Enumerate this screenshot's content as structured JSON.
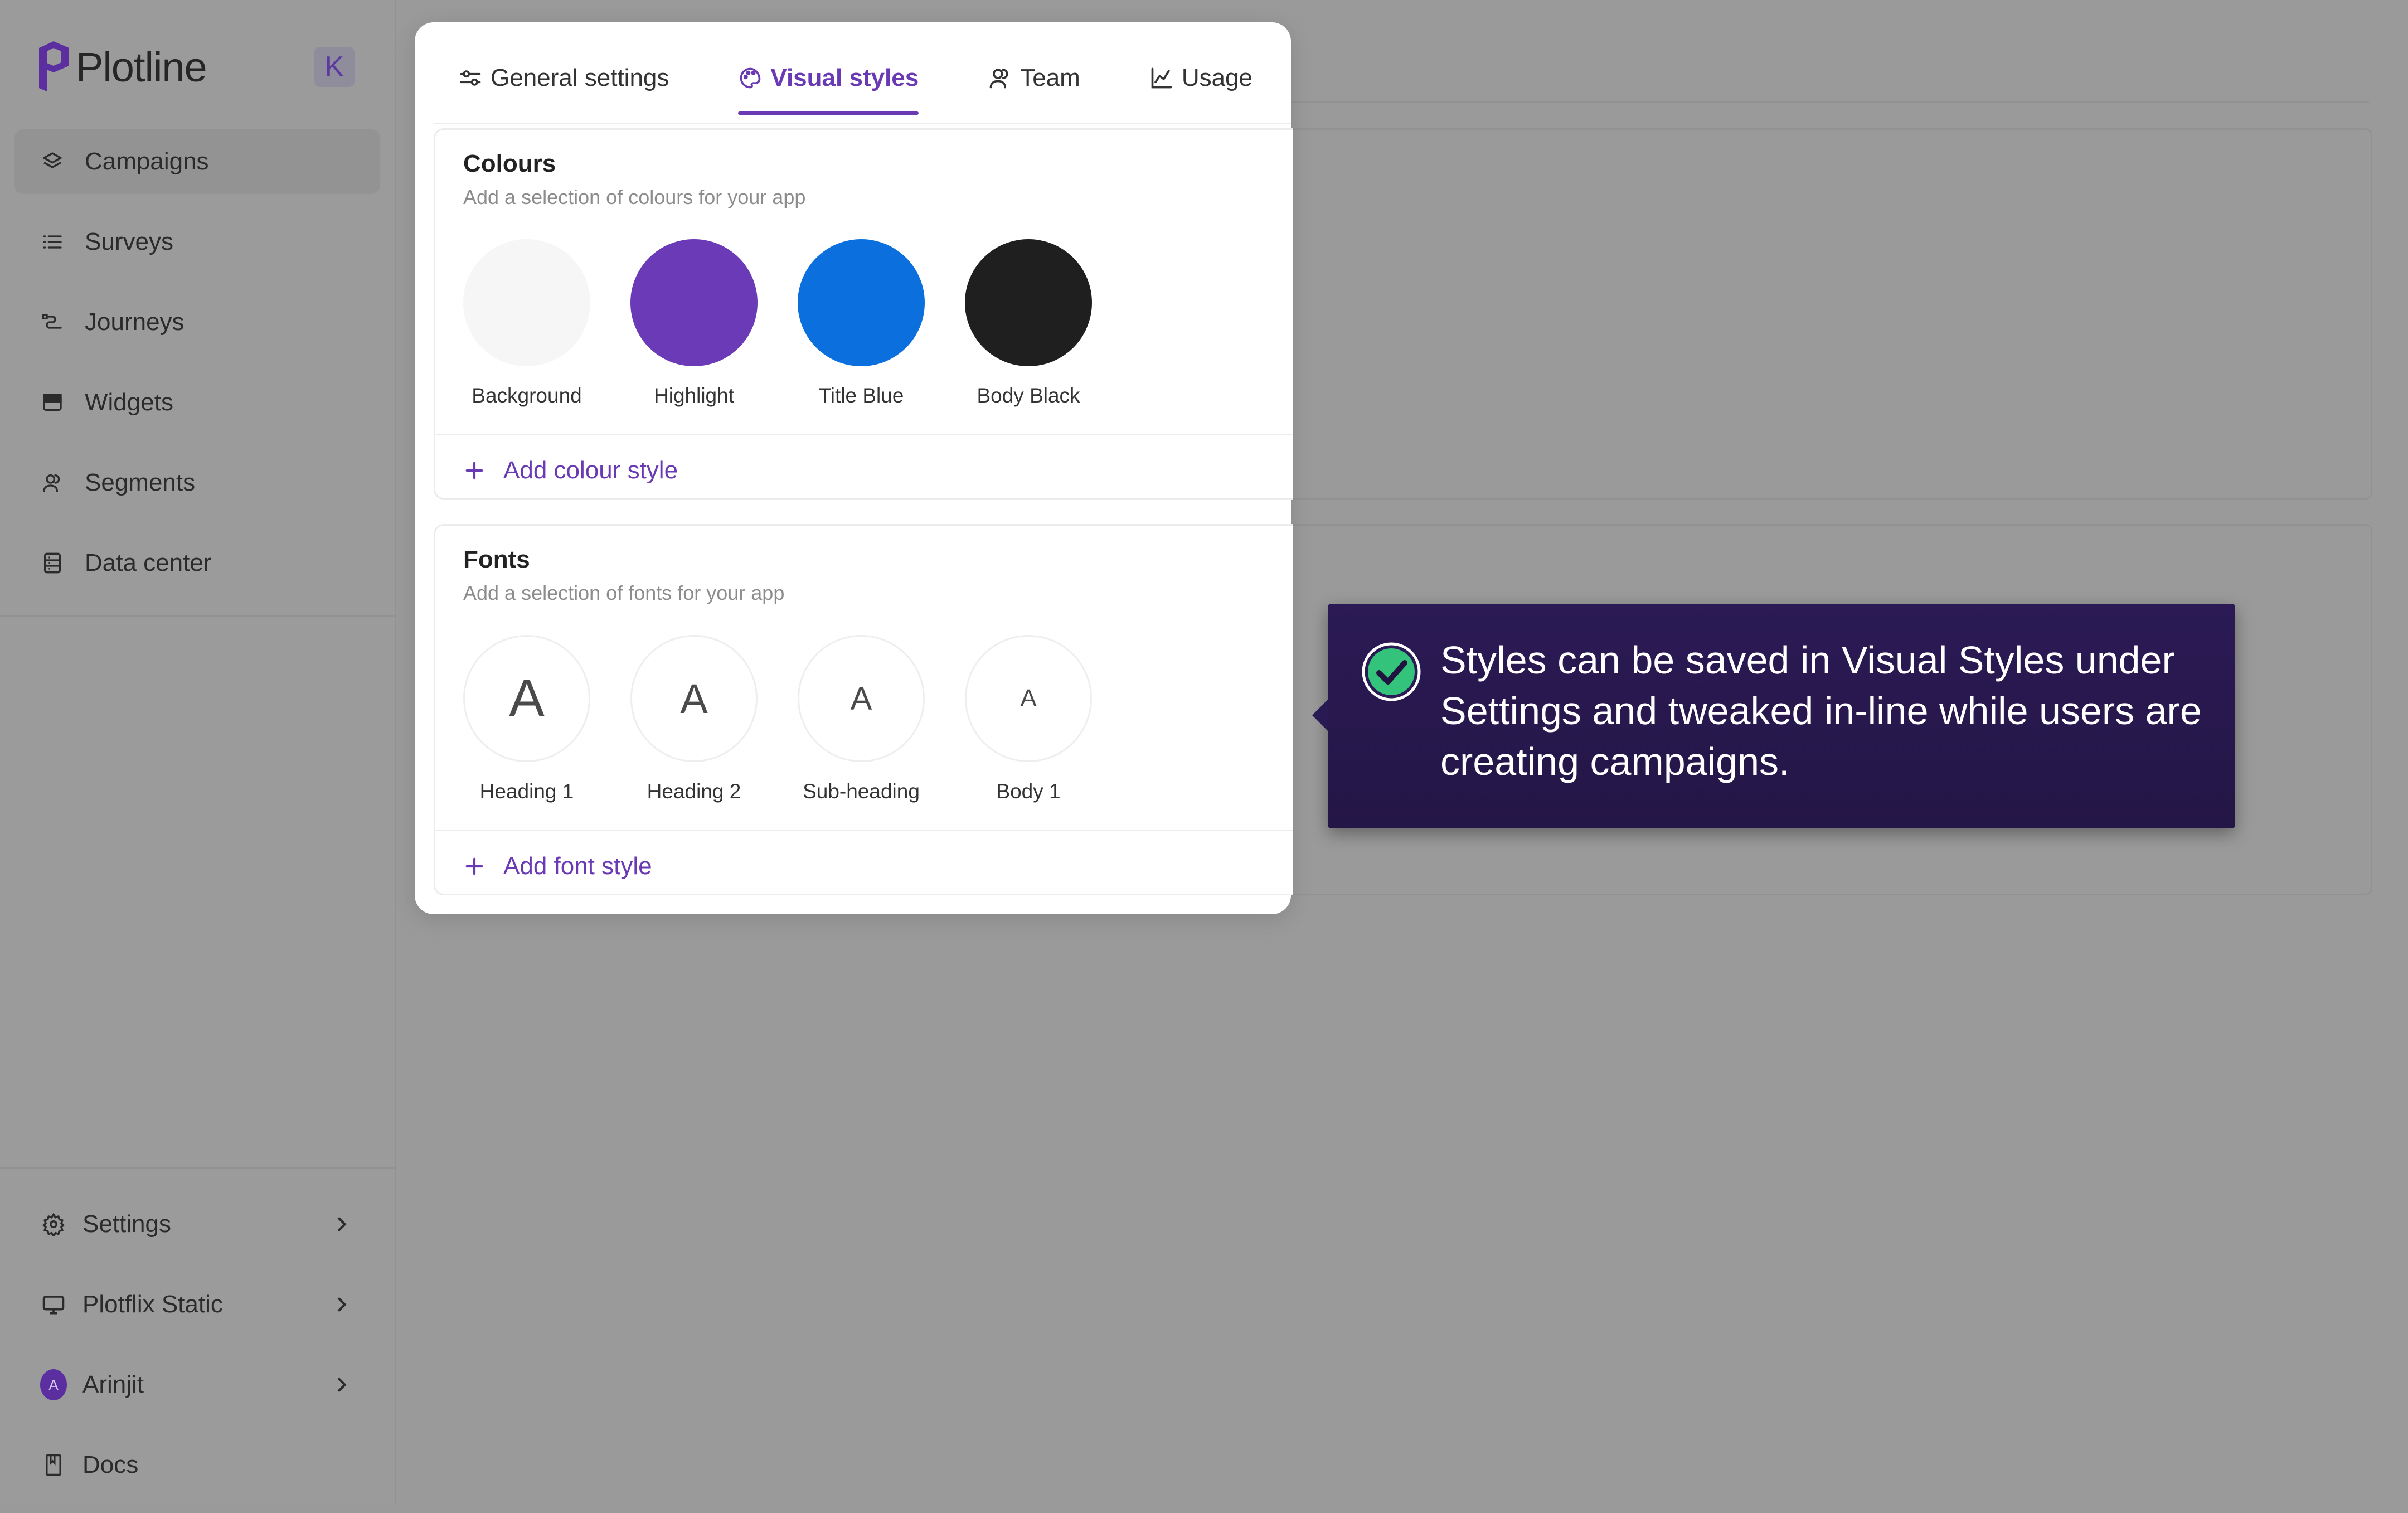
{
  "brand": {
    "name": "Plotline",
    "collapse_key": "K"
  },
  "sidebar": {
    "items": [
      {
        "label": "Campaigns",
        "icon": "layers-icon",
        "active": true
      },
      {
        "label": "Surveys",
        "icon": "list-icon"
      },
      {
        "label": "Journeys",
        "icon": "route-icon"
      },
      {
        "label": "Widgets",
        "icon": "widget-icon"
      },
      {
        "label": "Segments",
        "icon": "users-icon"
      },
      {
        "label": "Data center",
        "icon": "database-icon"
      }
    ],
    "bottom": [
      {
        "label": "Settings",
        "icon": "gear-icon"
      },
      {
        "label": "Plotflix Static",
        "icon": "monitor-icon"
      },
      {
        "label": "Arinjit",
        "avatar": "A"
      },
      {
        "label": "Docs",
        "icon": "book-icon"
      }
    ]
  },
  "settings": {
    "tabs": [
      {
        "label": "General settings",
        "icon": "sliders-icon"
      },
      {
        "label": "Visual styles",
        "icon": "palette-icon",
        "active": true
      },
      {
        "label": "Team",
        "icon": "team-icon"
      },
      {
        "label": "Usage",
        "icon": "chart-icon"
      }
    ],
    "colours": {
      "title": "Colours",
      "subtitle": "Add a selection of colours for your app",
      "swatches": [
        {
          "label": "Background",
          "color": "#f6f6f6"
        },
        {
          "label": "Highlight",
          "color": "#6b3ab7"
        },
        {
          "label": "Title Blue",
          "color": "#0b70de"
        },
        {
          "label": "Body Black",
          "color": "#1f1f1f"
        }
      ],
      "add_label": "Add colour style"
    },
    "fonts": {
      "title": "Fonts",
      "subtitle": "Add a selection of fonts for your app",
      "styles": [
        {
          "label": "Heading 1",
          "glyph": "A"
        },
        {
          "label": "Heading 2",
          "glyph": "A"
        },
        {
          "label": "Sub-heading",
          "glyph": "A"
        },
        {
          "label": "Body 1",
          "glyph": "A"
        }
      ],
      "add_label": "Add font style"
    }
  },
  "tooltip": {
    "text": "Styles can be saved in Visual Styles under Settings and tweaked in-line while users are creating campaigns."
  },
  "colors": {
    "accent": "#6a39b4",
    "tooltip_bg": "#2b1a55",
    "check": "#34c37a"
  }
}
